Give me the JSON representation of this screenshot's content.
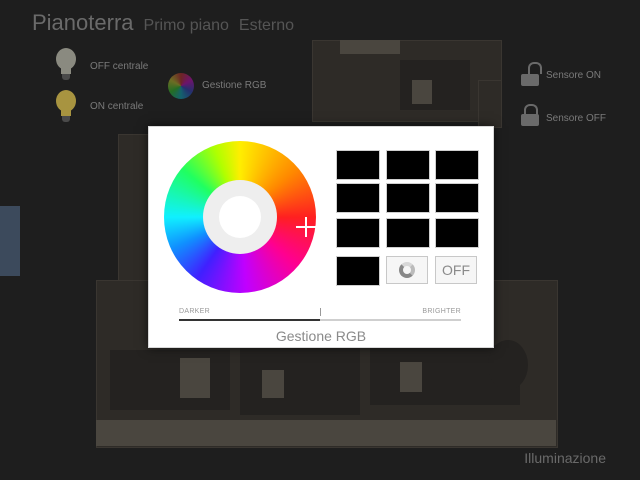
{
  "tabs": [
    {
      "label": "Pianoterra"
    },
    {
      "label": "Primo piano"
    },
    {
      "label": "Esterno"
    }
  ],
  "controls": {
    "off_centrale": "OFF centrale",
    "on_centrale": "ON centrale",
    "gestione_rgb": "Gestione RGB",
    "sensore_on": "Sensore ON",
    "sensore_off": "Sensore OFF"
  },
  "footer": {
    "title": "Illuminazione"
  },
  "popup": {
    "title": "Gestione RGB",
    "darker_label": "DARKER",
    "brighter_label": "BRIGHTER",
    "off_button": "OFF",
    "brightness_level": 0.5,
    "swatch_colors": [
      "#000000",
      "#000000",
      "#000000",
      "#000000",
      "#000000",
      "#000000",
      "#000000",
      "#000000",
      "#000000",
      "#000000"
    ]
  }
}
